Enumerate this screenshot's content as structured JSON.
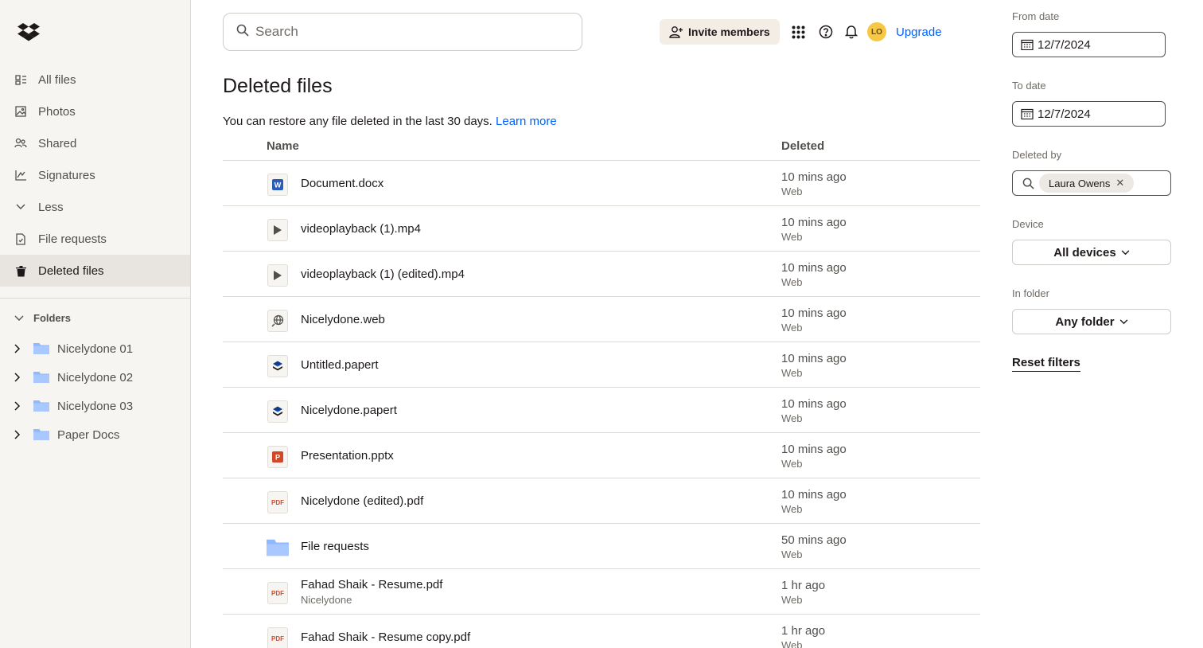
{
  "sidebar": {
    "items": [
      {
        "label": "All files",
        "icon": "all-files-icon"
      },
      {
        "label": "Photos",
        "icon": "photos-icon"
      },
      {
        "label": "Shared",
        "icon": "shared-icon"
      },
      {
        "label": "Signatures",
        "icon": "signatures-icon"
      },
      {
        "label": "Less",
        "icon": "chevron-down-icon"
      },
      {
        "label": "File requests",
        "icon": "file-requests-icon"
      },
      {
        "label": "Deleted files",
        "icon": "trash-icon",
        "active": true
      }
    ],
    "folders_heading": "Folders",
    "folders": [
      "Nicelydone 01",
      "Nicelydone 02",
      "Nicelydone 03",
      "Paper Docs"
    ]
  },
  "topbar": {
    "search_placeholder": "Search",
    "invite_label": "Invite members",
    "avatar_initials": "LO",
    "upgrade_label": "Upgrade"
  },
  "main": {
    "title": "Deleted files",
    "subtitle": "You can restore any file deleted in the last 30 days.",
    "learn_more": "Learn more",
    "columns": {
      "name": "Name",
      "deleted": "Deleted"
    },
    "rows": [
      {
        "name": "Document.docx",
        "sub": "",
        "type": "word",
        "when": "10 mins ago",
        "device": "Web"
      },
      {
        "name": "videoplayback (1).mp4",
        "sub": "",
        "type": "video",
        "when": "10 mins ago",
        "device": "Web"
      },
      {
        "name": "videoplayback (1) (edited).mp4",
        "sub": "",
        "type": "video",
        "when": "10 mins ago",
        "device": "Web"
      },
      {
        "name": "Nicelydone.web",
        "sub": "",
        "type": "web",
        "when": "10 mins ago",
        "device": "Web"
      },
      {
        "name": "Untitled.papert",
        "sub": "",
        "type": "paper",
        "when": "10 mins ago",
        "device": "Web"
      },
      {
        "name": "Nicelydone.papert",
        "sub": "",
        "type": "paper",
        "when": "10 mins ago",
        "device": "Web"
      },
      {
        "name": "Presentation.pptx",
        "sub": "",
        "type": "powerpoint",
        "when": "10 mins ago",
        "device": "Web"
      },
      {
        "name": "Nicelydone (edited).pdf",
        "sub": "",
        "type": "pdf",
        "when": "10 mins ago",
        "device": "Web"
      },
      {
        "name": "File requests",
        "sub": "",
        "type": "folder",
        "when": "50 mins ago",
        "device": "Web"
      },
      {
        "name": "Fahad Shaik - Resume.pdf",
        "sub": "Nicelydone",
        "type": "pdf",
        "when": "1 hr ago",
        "device": "Web"
      },
      {
        "name": "Fahad Shaik - Resume copy.pdf",
        "sub": "",
        "type": "pdf",
        "when": "1 hr ago",
        "device": "Web"
      }
    ],
    "pdf_tag": "PDF"
  },
  "filters": {
    "from_label": "From date",
    "from_value": "12/7/2024",
    "to_label": "To date",
    "to_value": "12/7/2024",
    "deleted_by_label": "Deleted by",
    "deleted_by_chip": "Laura Owens",
    "chip_remove": "✕",
    "device_label": "Device",
    "device_value": "All devices",
    "folder_label": "In folder",
    "folder_value": "Any folder",
    "reset_label": "Reset filters"
  },
  "colors": {
    "accent": "#0061fe",
    "sidebar_bg": "#f7f5f2",
    "active_bg": "#e8e4df",
    "folder_blue": "#8fb8ff"
  }
}
